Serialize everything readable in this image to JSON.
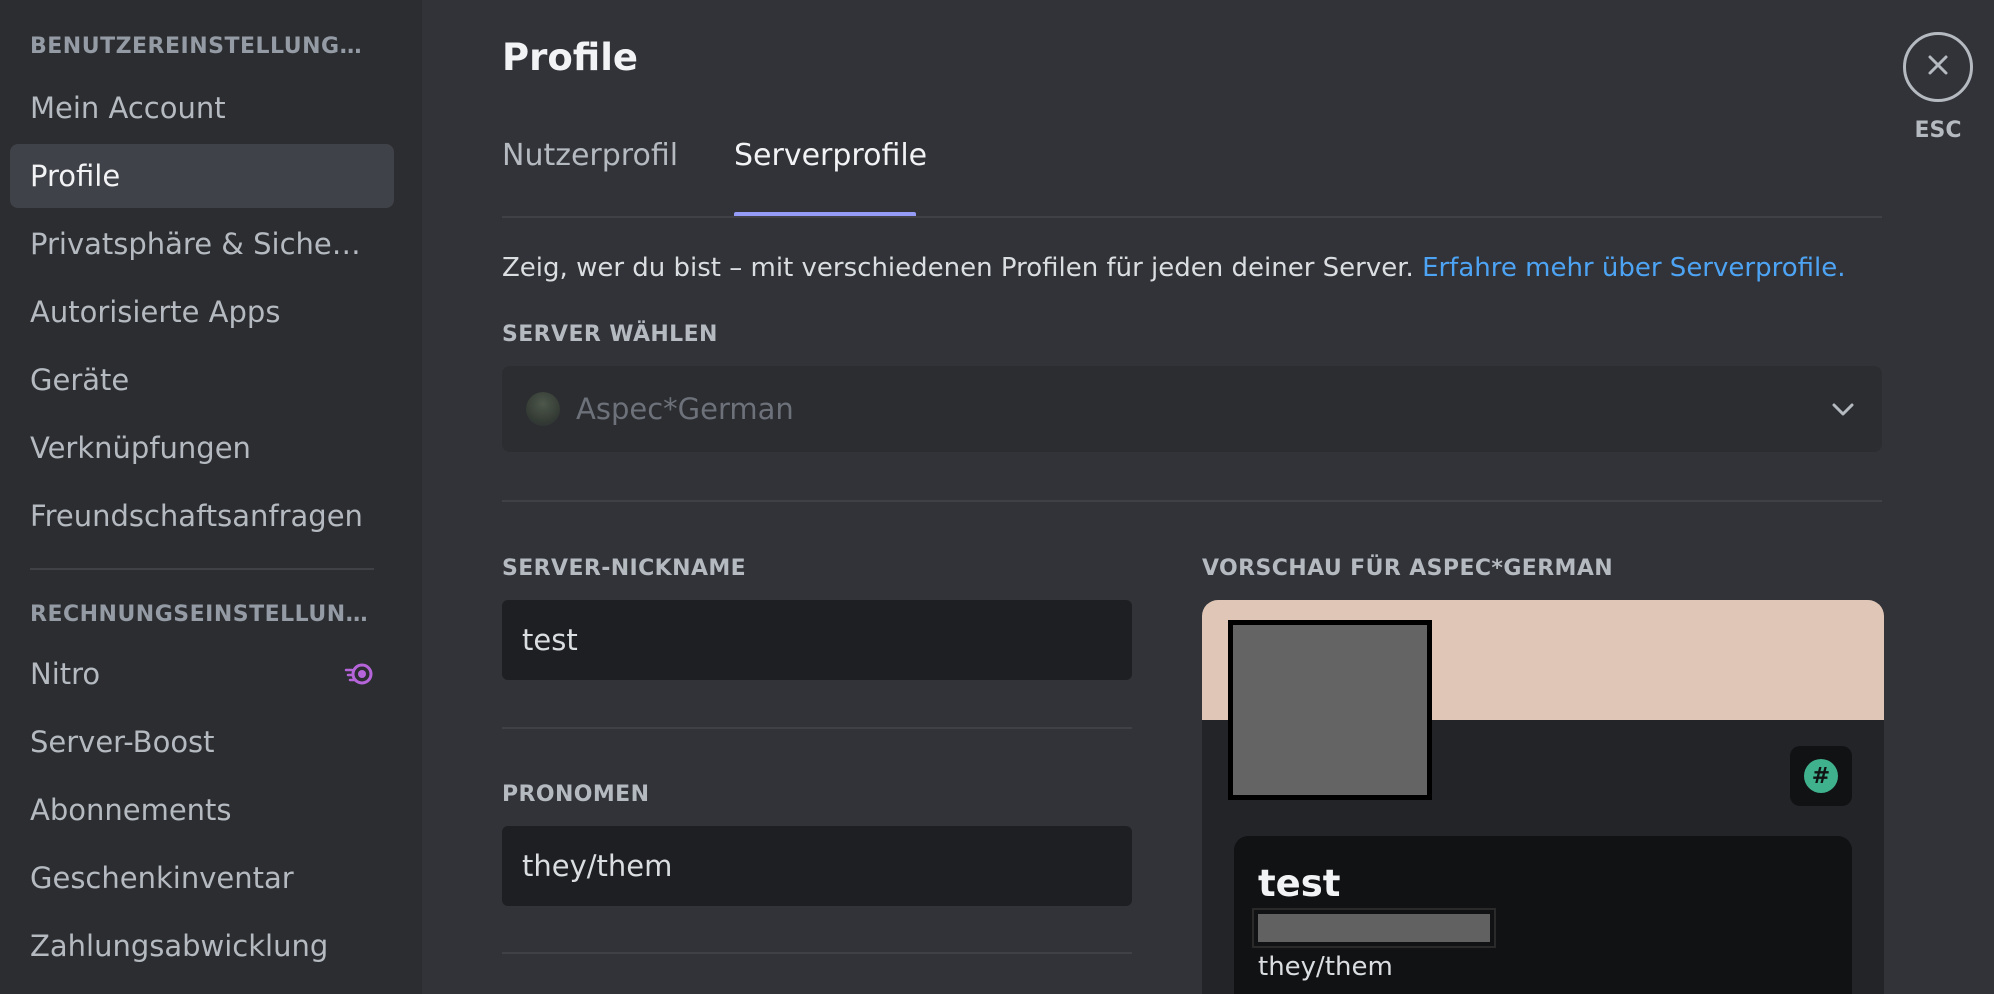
{
  "sidebar": {
    "user_settings_header": "BENUTZEREINSTELLUNGEN",
    "user_items": [
      {
        "label": "Mein Account"
      },
      {
        "label": "Profile"
      },
      {
        "label": "Privatsphäre & Sicherh..."
      },
      {
        "label": "Autorisierte Apps"
      },
      {
        "label": "Geräte"
      },
      {
        "label": "Verknüpfungen"
      },
      {
        "label": "Freundschaftsanfragen"
      }
    ],
    "billing_header": "RECHNUNGSEINSTELLUNG...",
    "billing_items": [
      {
        "label": "Nitro"
      },
      {
        "label": "Server-Boost"
      },
      {
        "label": "Abonnements"
      },
      {
        "label": "Geschenkinventar"
      },
      {
        "label": "Zahlungsabwicklung"
      }
    ],
    "active_item": "Profile"
  },
  "main": {
    "title": "Profile",
    "tabs": [
      {
        "label": "Nutzerprofil",
        "active": false
      },
      {
        "label": "Serverprofile",
        "active": true
      }
    ],
    "description": "Zeig, wer du bist – mit verschiedenen Profilen für jeden deiner Server. ",
    "description_link": "Erfahre mehr über Serverprofile.",
    "server_select_label": "SERVER WÄHLEN",
    "server_select_value": "Aspec*German",
    "nickname_label": "SERVER-NICKNAME",
    "nickname_value": "test",
    "pronouns_label": "PRONOMEN",
    "pronouns_value": "they/them",
    "preview_label": "VORSCHAU FÜR ASPEC*GERMAN"
  },
  "preview_card": {
    "name": "test",
    "pronouns": "they/them",
    "banner_color": "#e0c6b6",
    "badge_icon": "hashtag-badge-icon"
  },
  "close": {
    "esc_label": "ESC"
  },
  "colors": {
    "accent": "#949cf7",
    "link": "#4ea4f4",
    "nitro": "#b565d9"
  }
}
